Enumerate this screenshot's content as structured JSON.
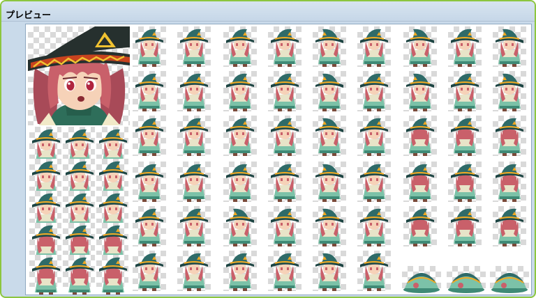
{
  "window": {
    "title": "プレビュー"
  },
  "preview": {
    "face_icon": "character-face-portrait",
    "sprite_icon": "witch-character-sprite",
    "colors": {
      "hat": "#2f6b68",
      "hat_dark": "#1d4543",
      "hat_band": "#f0a820",
      "hair": "#c9606a",
      "skin": "#f6d2b8",
      "dress": "#7cc2a8",
      "dress_dark": "#3f8a76",
      "cape": "#e8e4c8",
      "face_hat": "#26302e",
      "face_band": "#c8431e",
      "face_pattern": "#f1c231",
      "face_sweater": "#2e6e5a",
      "eye": "#b0243f"
    }
  }
}
